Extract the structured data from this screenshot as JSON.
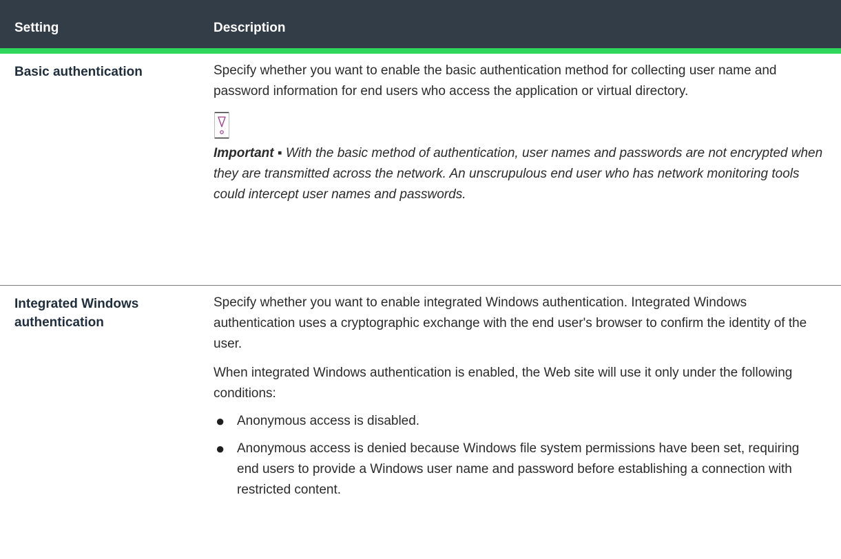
{
  "table": {
    "headers": {
      "setting": "Setting",
      "description": "Description"
    },
    "rows": [
      {
        "setting": "Basic authentication",
        "description": "Specify whether you want to enable the basic authentication method for collecting user name and password information for end users who access the application or virtual directory.",
        "note": {
          "icon": "important-note-icon",
          "lead": "Important ▪",
          "text": " With the basic method of authentication, user names and passwords are not encrypted when they are transmitted across the network. An unscrupulous end user who has network monitoring tools could intercept user names and passwords."
        }
      },
      {
        "setting_lines": [
          "Integrated Windows",
          "authentication"
        ],
        "paragraphs": [
          "Specify whether you want to enable integrated Windows authentication. Integrated Windows authentication uses a cryptographic exchange with the end user's browser to confirm the identity of the user.",
          "When integrated Windows authentication is enabled, the Web site will use it only under the following conditions:"
        ],
        "bullets": [
          "Anonymous access is disabled.",
          "Anonymous access is denied because Windows file system permissions have been set, requiring end users to provide a Windows user name and password before establishing a connection with restricted content."
        ]
      }
    ]
  },
  "colors": {
    "header_bg": "#323d48",
    "header_accent": "#2fd85c",
    "icon_color": "#a03a8c"
  }
}
